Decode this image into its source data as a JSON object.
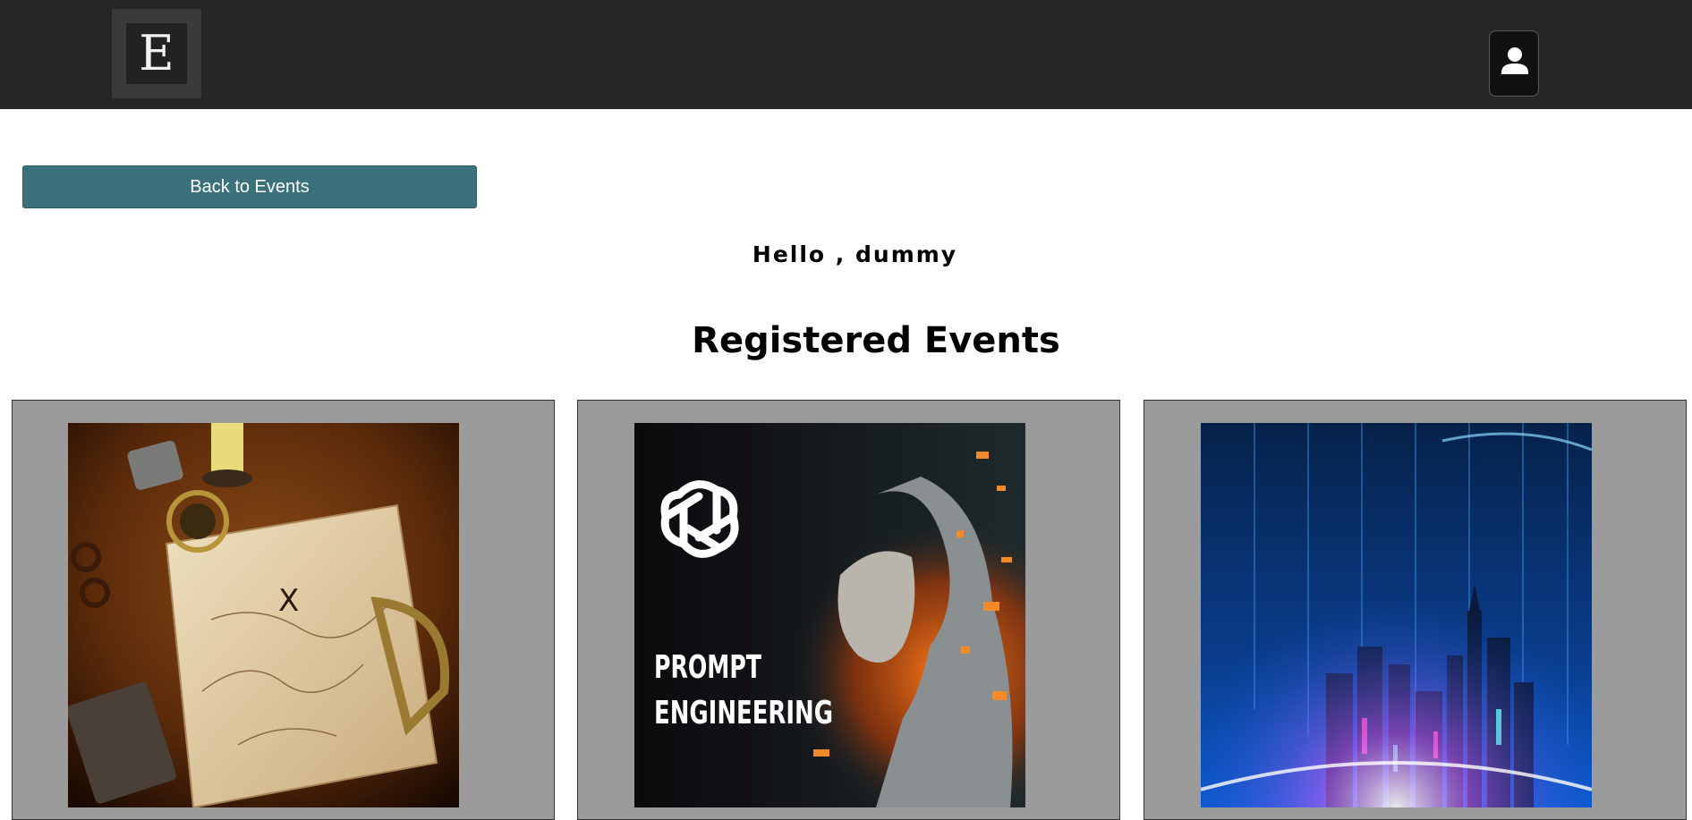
{
  "header": {
    "logo_letter": "E",
    "user_icon": "user-icon"
  },
  "actions": {
    "back_label": "Back to Events"
  },
  "greeting": "Hello , dummy",
  "section_title": "Registered Events",
  "events": [
    {
      "image": "treasure-map-image",
      "caption": ""
    },
    {
      "image": "prompt-engineering-image",
      "caption": "PROMPT\nENGINEERING"
    },
    {
      "image": "neon-city-image",
      "caption": ""
    }
  ],
  "colors": {
    "header_bg": "#262626",
    "button_bg": "#3a717b",
    "card_bg": "#9b9b9b"
  }
}
